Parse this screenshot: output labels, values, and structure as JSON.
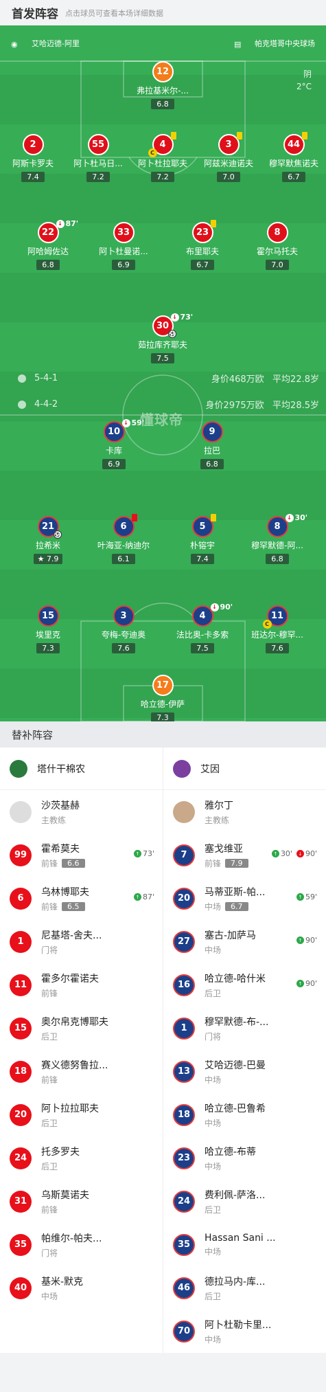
{
  "header": {
    "title": "首发阵容",
    "subtitle": "点击球员可查看本场详细数据"
  },
  "pitch": {
    "referee": "艾哈迈德-阿里",
    "stadium": "帕克塔哥中央球场",
    "weather": "阴",
    "temperature": "2°C",
    "watermark": "懂球帝"
  },
  "home": {
    "formation": "5-4-1",
    "value": "身价468万欧",
    "age": "平均22.8岁",
    "players": [
      {
        "num": "12",
        "name": "弗拉基米尔-...",
        "rating": "6.8"
      },
      {
        "num": "2",
        "name": "阿斯卡罗夫",
        "rating": "7.4"
      },
      {
        "num": "55",
        "name": "阿卜杜马日...",
        "rating": "7.2"
      },
      {
        "num": "4",
        "name": "阿卜杜拉耶夫",
        "rating": "7.2"
      },
      {
        "num": "3",
        "name": "阿兹米迪诺夫",
        "rating": "7.0"
      },
      {
        "num": "44",
        "name": "穆罕默焦诺夫",
        "rating": "6.7"
      },
      {
        "num": "22",
        "name": "阿哈姆佐达",
        "rating": "6.8",
        "sub": "87'"
      },
      {
        "num": "33",
        "name": "阿卜杜曼诺...",
        "rating": "6.9"
      },
      {
        "num": "23",
        "name": "布里耶夫",
        "rating": "6.7"
      },
      {
        "num": "8",
        "name": "霍尔马托夫",
        "rating": "7.0"
      },
      {
        "num": "30",
        "name": "茹拉库齐耶夫",
        "rating": "7.5",
        "sub": "73'"
      }
    ]
  },
  "away": {
    "formation": "4-4-2",
    "value": "身价2975万欧",
    "age": "平均28.5岁",
    "players": [
      {
        "num": "10",
        "name": "卡库",
        "rating": "6.9",
        "sub": "59'"
      },
      {
        "num": "9",
        "name": "拉巴",
        "rating": "6.8"
      },
      {
        "num": "21",
        "name": "拉希米",
        "rating": "7.9"
      },
      {
        "num": "6",
        "name": "叶海亚-纳迪尔",
        "rating": "6.1"
      },
      {
        "num": "5",
        "name": "朴镕宇",
        "rating": "7.4"
      },
      {
        "num": "8",
        "name": "穆罕默德-阿...",
        "rating": "6.8",
        "sub": "30'"
      },
      {
        "num": "15",
        "name": "埃里克",
        "rating": "7.3"
      },
      {
        "num": "3",
        "name": "夸梅-夸迪奥",
        "rating": "7.6"
      },
      {
        "num": "4",
        "name": "法比奥-卡多索",
        "rating": "7.5",
        "sub": "90'"
      },
      {
        "num": "11",
        "name": "班达尔-穆罕...",
        "rating": "7.6"
      },
      {
        "num": "17",
        "name": "哈立德-伊萨",
        "rating": "7.3"
      }
    ]
  },
  "subs": {
    "title": "替补阵容",
    "home_team": "塔什干棉农",
    "away_team": "艾因",
    "home_coach": {
      "name": "沙茨基赫",
      "role": "主教练"
    },
    "away_coach": {
      "name": "雅尔丁",
      "role": "主教练"
    },
    "home_list": [
      {
        "num": "99",
        "name": "霍希莫夫",
        "pos": "前锋",
        "rating": "6.6",
        "ev": "73'"
      },
      {
        "num": "6",
        "name": "乌林博耶夫",
        "pos": "前锋",
        "rating": "6.5",
        "ev": "87'"
      },
      {
        "num": "1",
        "name": "尼基塔-舍夫...",
        "pos": "门将"
      },
      {
        "num": "11",
        "name": "霍多尔霍诺夫",
        "pos": "前锋"
      },
      {
        "num": "15",
        "name": "奥尔帛克博耶夫",
        "pos": "后卫"
      },
      {
        "num": "18",
        "name": "赛义德努鲁拉...",
        "pos": "前锋"
      },
      {
        "num": "20",
        "name": "阿卜拉拉耶夫",
        "pos": "后卫"
      },
      {
        "num": "24",
        "name": "托多罗夫",
        "pos": "后卫"
      },
      {
        "num": "31",
        "name": "乌斯莫诺夫",
        "pos": "前锋"
      },
      {
        "num": "35",
        "name": "帕维尔-帕夫...",
        "pos": "门将"
      },
      {
        "num": "40",
        "name": "基米-默克",
        "pos": "中场"
      }
    ],
    "away_list": [
      {
        "num": "7",
        "name": "塞戈维亚",
        "pos": "前锋",
        "rating": "7.9",
        "ev_in": "30'",
        "ev_out": "90'"
      },
      {
        "num": "20",
        "name": "马蒂亚斯-帕...",
        "pos": "中场",
        "rating": "6.7",
        "ev": "59'"
      },
      {
        "num": "27",
        "name": "塞古-加萨马",
        "pos": "中场",
        "ev": "90'"
      },
      {
        "num": "16",
        "name": "哈立德-哈什米",
        "pos": "后卫",
        "ev": "90'"
      },
      {
        "num": "1",
        "name": "穆罕默德-布-...",
        "pos": "门将"
      },
      {
        "num": "13",
        "name": "艾哈迈德-巴曼",
        "pos": "中场"
      },
      {
        "num": "18",
        "name": "哈立德-巴鲁希",
        "pos": "中场"
      },
      {
        "num": "23",
        "name": "哈立德-布蒂",
        "pos": "中场"
      },
      {
        "num": "24",
        "name": "费利佩-萨洛...",
        "pos": "后卫"
      },
      {
        "num": "35",
        "name": "Hassan Sani ...",
        "pos": "中场"
      },
      {
        "num": "46",
        "name": "德拉马内-库...",
        "pos": "后卫"
      },
      {
        "num": "70",
        "name": "阿卜杜勒卡里...",
        "pos": "中场"
      }
    ]
  }
}
